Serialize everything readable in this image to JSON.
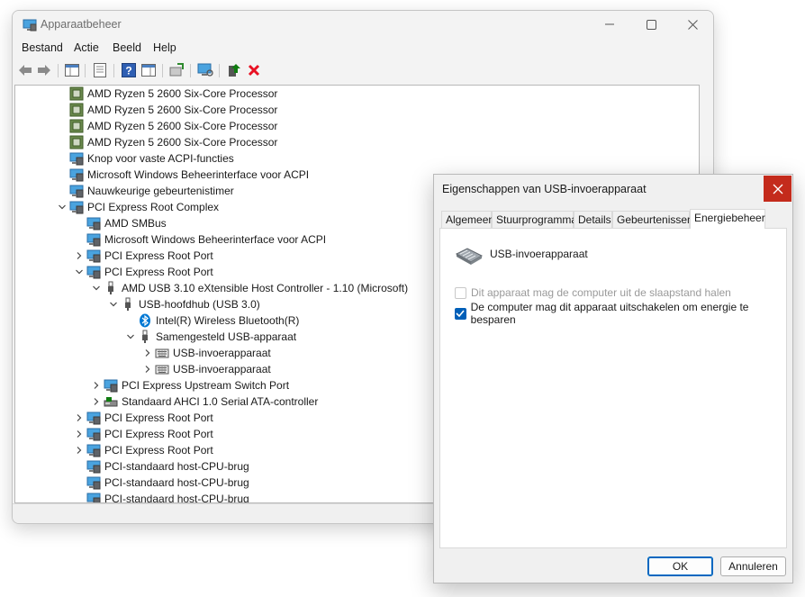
{
  "window": {
    "title": "Apparaatbeheer",
    "menu": [
      "Bestand",
      "Actie",
      "Beeld",
      "Help"
    ]
  },
  "tree": [
    {
      "label": "AMD Ryzen 5 2600 Six-Core Processor",
      "icon": "processor-icon",
      "expander": "none"
    },
    {
      "label": "AMD Ryzen 5 2600 Six-Core Processor",
      "icon": "processor-icon",
      "expander": "none"
    },
    {
      "label": "AMD Ryzen 5 2600 Six-Core Processor",
      "icon": "processor-icon",
      "expander": "none"
    },
    {
      "label": "AMD Ryzen 5 2600 Six-Core Processor",
      "icon": "processor-icon",
      "expander": "none"
    },
    {
      "label": "Knop voor vaste ACPI-functies",
      "icon": "system-device-icon",
      "expander": "none"
    },
    {
      "label": "Microsoft Windows Beheerinterface voor ACPI",
      "icon": "system-device-icon",
      "expander": "none"
    },
    {
      "label": "Nauwkeurige gebeurtenistimer",
      "icon": "system-device-icon",
      "expander": "none"
    },
    {
      "label": "PCI Express Root Complex",
      "icon": "system-device-icon",
      "expander": "expanded"
    },
    {
      "label": "AMD SMBus",
      "icon": "system-device-icon",
      "expander": "none"
    },
    {
      "label": "Microsoft Windows Beheerinterface voor ACPI",
      "icon": "system-device-icon",
      "expander": "none"
    },
    {
      "label": "PCI Express Root Port",
      "icon": "system-device-icon",
      "expander": "collapsed"
    },
    {
      "label": "PCI Express Root Port",
      "icon": "system-device-icon",
      "expander": "expanded"
    },
    {
      "label": "AMD USB 3.10 eXtensible Host Controller - 1.10 (Microsoft)",
      "icon": "usb-plug-icon",
      "expander": "expanded"
    },
    {
      "label": "USB-hoofdhub (USB 3.0)",
      "icon": "usb-plug-icon",
      "expander": "expanded"
    },
    {
      "label": "Intel(R) Wireless Bluetooth(R)",
      "icon": "bluetooth-icon",
      "expander": "none"
    },
    {
      "label": "Samengesteld USB-apparaat",
      "icon": "usb-plug-icon",
      "expander": "expanded"
    },
    {
      "label": "USB-invoerapparaat",
      "icon": "keyboard-icon",
      "expander": "collapsed"
    },
    {
      "label": "USB-invoerapparaat",
      "icon": "keyboard-icon",
      "expander": "collapsed"
    },
    {
      "label": "PCI Express Upstream Switch Port",
      "icon": "system-device-icon",
      "expander": "collapsed"
    },
    {
      "label": "Standaard AHCI 1.0 Serial ATA-controller",
      "icon": "storage-controller-icon",
      "expander": "collapsed"
    },
    {
      "label": "PCI Express Root Port",
      "icon": "system-device-icon",
      "expander": "collapsed"
    },
    {
      "label": "PCI Express Root Port",
      "icon": "system-device-icon",
      "expander": "collapsed"
    },
    {
      "label": "PCI Express Root Port",
      "icon": "system-device-icon",
      "expander": "collapsed"
    },
    {
      "label": "PCI-standaard host-CPU-brug",
      "icon": "system-device-icon",
      "expander": "none"
    },
    {
      "label": "PCI-standaard host-CPU-brug",
      "icon": "system-device-icon",
      "expander": "none"
    },
    {
      "label": "PCI-standaard host-CPU-brug",
      "icon": "system-device-icon",
      "expander": "none"
    }
  ],
  "dialog": {
    "title": "Eigenschappen van USB-invoerapparaat",
    "tabs": [
      "Algemeen",
      "Stuurprogramma",
      "Details",
      "Gebeurtenissen",
      "Energiebeheer"
    ],
    "active_tab": "Energiebeheer",
    "device_name": "USB-invoerapparaat",
    "options": [
      {
        "label": "Dit apparaat mag de computer uit de slaapstand halen",
        "checked": false,
        "enabled": false
      },
      {
        "label": "De computer mag dit apparaat uitschakelen om energie te besparen",
        "checked": true,
        "enabled": true
      }
    ],
    "ok_label": "OK",
    "cancel_label": "Annuleren"
  },
  "colors": {
    "accent": "#005fb8",
    "close_red": "#c42b1c",
    "error_red": "#e81123",
    "usb_green": "#107c10"
  }
}
